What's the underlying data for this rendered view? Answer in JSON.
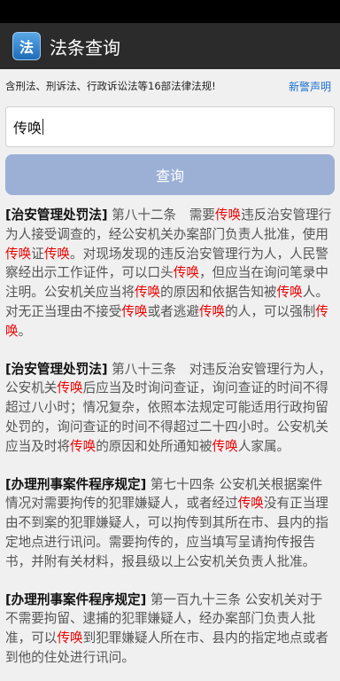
{
  "app": {
    "icon_text": "法",
    "title": "法条查询"
  },
  "header": {
    "description": "含刑法、刑诉法、行政诉讼法等16部法律法规!",
    "disclaimer_link": "新警声明"
  },
  "search": {
    "value": "传唤",
    "button_label": "查询"
  },
  "results": [
    {
      "law": "[治安管理处罚法]",
      "segments": [
        {
          "t": " 第八十二条　需要"
        },
        {
          "t": "传唤",
          "h": 1
        },
        {
          "t": "违反治安管理行为人接受调查的，经公安机关办案部门负责人批准，使用"
        },
        {
          "t": "传唤",
          "h": 1
        },
        {
          "t": "证"
        },
        {
          "t": "传唤",
          "h": 1
        },
        {
          "t": "。对现场发现的违反治安管理行为人，人民警察经出示工作证件，可以口头"
        },
        {
          "t": "传唤",
          "h": 1
        },
        {
          "t": "，但应当在询问笔录中注明。公安机关应当将"
        },
        {
          "t": "传唤",
          "h": 1
        },
        {
          "t": "的原因和依据告知被"
        },
        {
          "t": "传唤",
          "h": 1
        },
        {
          "t": "人。对无正当理由不接受"
        },
        {
          "t": "传唤",
          "h": 1
        },
        {
          "t": "或者逃避"
        },
        {
          "t": "传唤",
          "h": 1
        },
        {
          "t": "的人，可以强制"
        },
        {
          "t": "传唤",
          "h": 1
        },
        {
          "t": "。"
        }
      ]
    },
    {
      "law": "[治安管理处罚法]",
      "segments": [
        {
          "t": " 第八十三条　对违反治安管理行为人，公安机关"
        },
        {
          "t": "传唤",
          "h": 1
        },
        {
          "t": "后应当及时询问查证，询问查证的时间不得超过八小时；情况复杂，依照本法规定可能适用行政拘留处罚的，询问查证的时间不得超过二十四小时。公安机关应当及时将"
        },
        {
          "t": "传唤",
          "h": 1
        },
        {
          "t": "的原因和处所通知被"
        },
        {
          "t": "传唤",
          "h": 1
        },
        {
          "t": "人家属。"
        }
      ]
    },
    {
      "law": "[办理刑事案件程序规定]",
      "segments": [
        {
          "t": " 第七十四条 公安机关根据案件情况对需要拘传的犯罪嫌疑人，或者经过"
        },
        {
          "t": "传唤",
          "h": 1
        },
        {
          "t": "没有正当理由不到案的犯罪嫌疑人，可以拘传到其所在市、县内的指定地点进行讯问。需要拘传的，应当填写呈请拘传报告书，并附有关材料，报县级以上公安机关负责人批准。"
        }
      ]
    },
    {
      "law": "[办理刑事案件程序规定]",
      "segments": [
        {
          "t": " 第一百九十三条 公安机关对于不需要拘留、逮捕的犯罪嫌疑人，经办案部门负责人批准，可以"
        },
        {
          "t": "传唤",
          "h": 1
        },
        {
          "t": "到犯罪嫌疑人所在市、县内的指定地点或者到他的住处进行讯问。"
        }
      ]
    }
  ]
}
